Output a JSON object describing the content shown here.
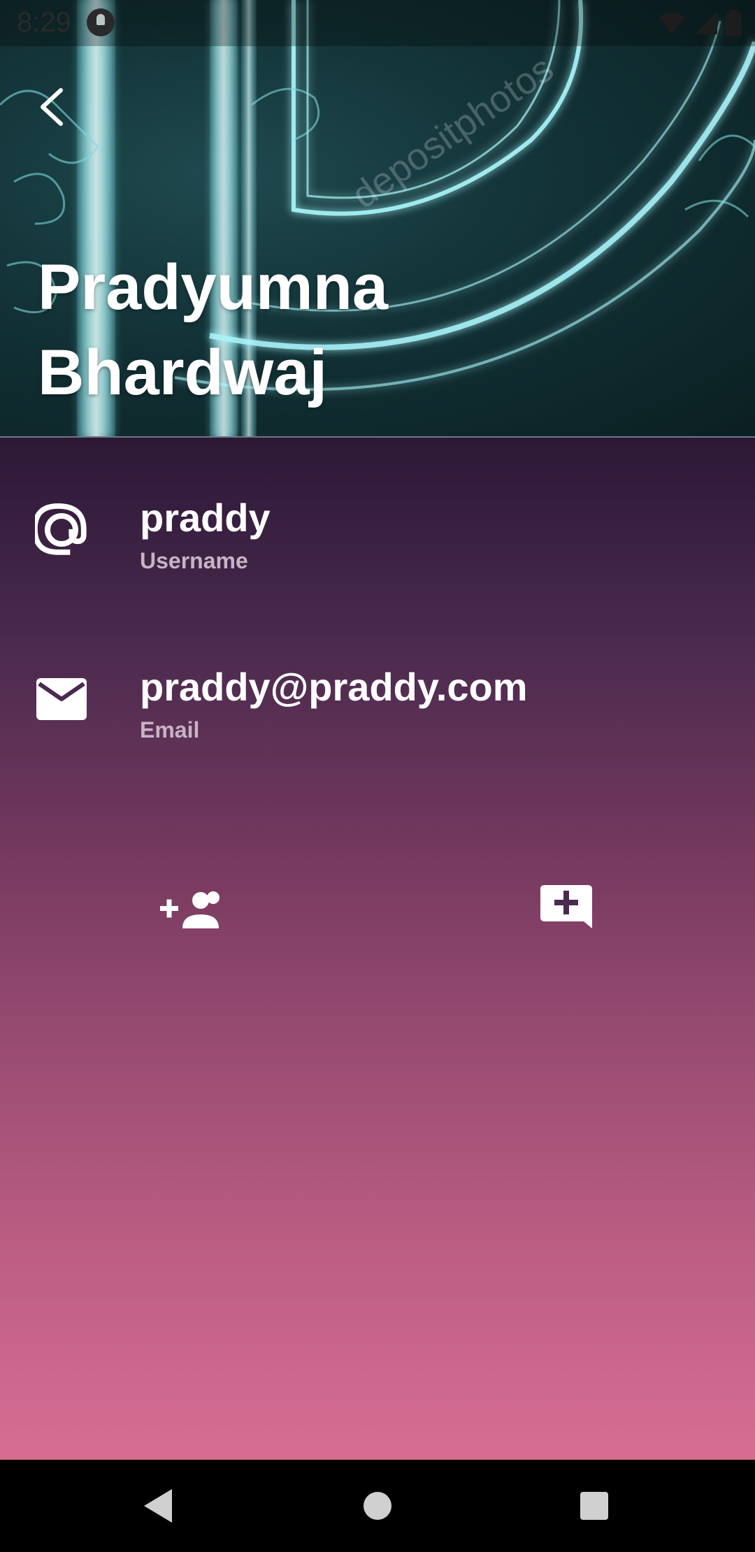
{
  "status_bar": {
    "time": "8:29"
  },
  "header": {
    "back_label": "Back",
    "name": "Pradyumna Bhardwaj"
  },
  "fields": [
    {
      "value": "praddy",
      "label": "Username",
      "icon": "at-sign-icon"
    },
    {
      "value": "praddy@praddy.com",
      "label": "Email",
      "icon": "mail-icon"
    }
  ],
  "actions": {
    "add_friend_icon": "person-add-icon",
    "new_message_icon": "add-comment-icon"
  },
  "colors": {
    "header_bg": "#123236",
    "gradient_top": "#2c1836",
    "gradient_bottom": "#d76d93",
    "text_primary": "#ffffff",
    "text_secondary": "#c7b3c4"
  }
}
